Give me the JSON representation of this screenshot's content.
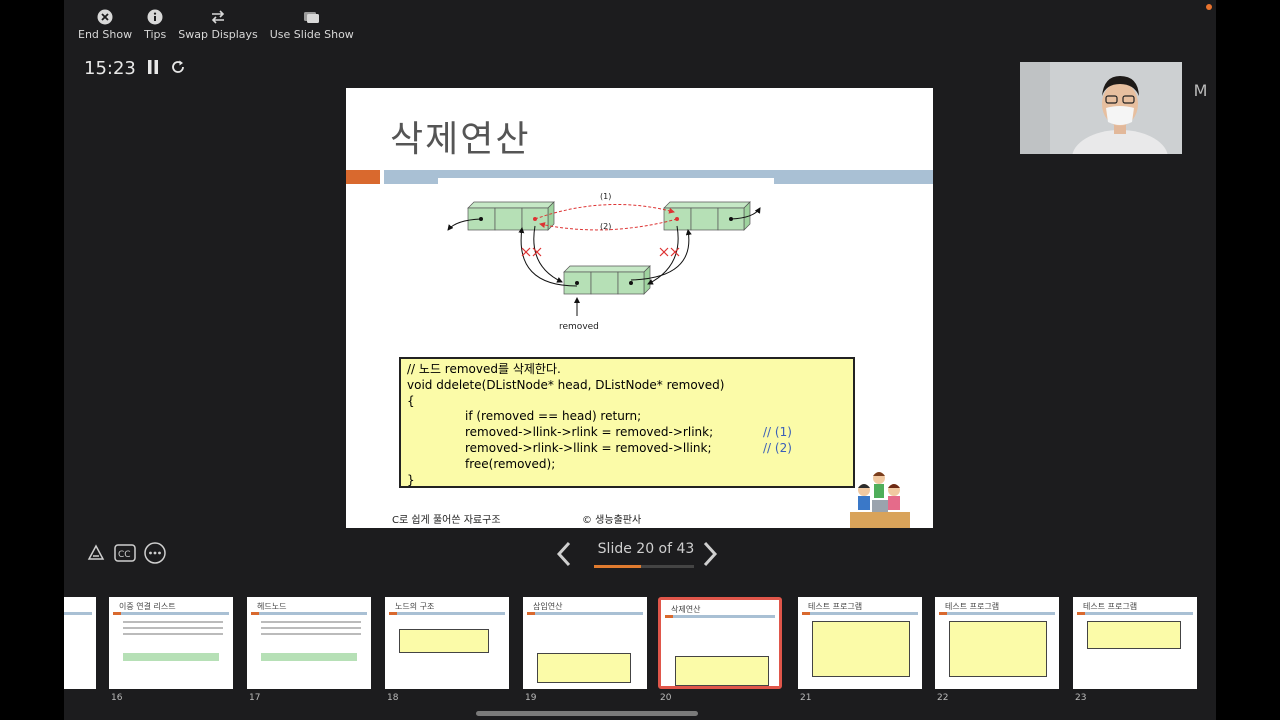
{
  "toolbar": {
    "end_show": "End Show",
    "tips": "Tips",
    "swap_displays": "Swap Displays",
    "use_slide_show": "Use Slide Show"
  },
  "timer": {
    "time": "15:23"
  },
  "clock_partial": "M",
  "slide": {
    "title": "삭제연산",
    "diagram": {
      "label_1": "(1)",
      "label_2": "(2)",
      "removed": "removed"
    },
    "code": {
      "line1": "// 노드 removed를 삭제한다.",
      "line2": "void ddelete(DListNode* head, DListNode* removed)",
      "line3": "{",
      "line4": "if (removed == head) return;",
      "line5": "removed->llink->rlink = removed->rlink;",
      "line5_comment": "// (1)",
      "line6": "removed->rlink->llink = removed->llink;",
      "line6_comment": "// (2)",
      "line7": "free(removed);",
      "line8": "}"
    },
    "footer_left": "C로 쉽게 풀어쓴 자료구조",
    "footer_right": "© 생능출판사"
  },
  "navigation": {
    "counter": "Slide 20 of 43",
    "progress": 0.465
  },
  "thumbnails": [
    {
      "title": "",
      "num": ""
    },
    {
      "title": "이중 연결 리스트",
      "num": "16"
    },
    {
      "title": "헤드노드",
      "num": "17"
    },
    {
      "title": "노드의 구조",
      "num": "18"
    },
    {
      "title": "삽입연산",
      "num": "19"
    },
    {
      "title": "삭제연산",
      "num": "20"
    },
    {
      "title": "테스트 프로그램",
      "num": "21"
    },
    {
      "title": "테스트 프로그램",
      "num": "22"
    },
    {
      "title": "테스트 프로그램",
      "num": "23"
    }
  ],
  "colors": {
    "accent": "#e07b2f",
    "active_thumb": "#e0564a",
    "code_bg": "#fbfba8",
    "slide_bar_blue": "#a9c0d4",
    "slide_bar_orange": "#d9692e"
  }
}
